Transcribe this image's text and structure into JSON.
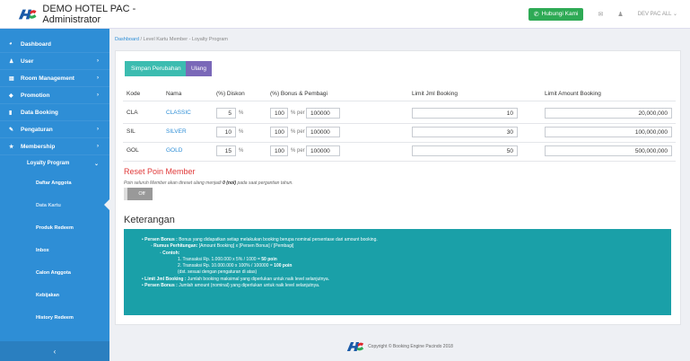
{
  "header": {
    "title": "DEMO HOTEL PAC - Administrator",
    "hubungi_label": "Hubungi Kami",
    "user_label": "DEV PAC ALL"
  },
  "sidebar": {
    "items": [
      {
        "label": "Dashboard",
        "icon": "dashboard-icon",
        "chevron": false
      },
      {
        "label": "User",
        "icon": "user-icon",
        "chevron": true
      },
      {
        "label": "Room Management",
        "icon": "room-icon",
        "chevron": true
      },
      {
        "label": "Promotion",
        "icon": "tag-icon",
        "chevron": true
      },
      {
        "label": "Data Booking",
        "icon": "book-icon",
        "chevron": false
      },
      {
        "label": "Pengaturan",
        "icon": "wrench-icon",
        "chevron": true
      },
      {
        "label": "Membership",
        "icon": "star-icon",
        "chevron": true
      }
    ],
    "submenu": "Loyalty Program",
    "subitems": [
      "Daftar Anggota",
      "Data Kartu",
      "Produk Redeem",
      "Inbox",
      "Calon Anggota",
      "Kebijakan",
      "History Redeem"
    ],
    "bottom_chevron": "‹"
  },
  "breadcrumb": {
    "home": "Dashboard",
    "separator": "/",
    "path": "Level Kartu Member - Loyalty Program"
  },
  "toolbar": {
    "save_label": "Simpan Perubahan",
    "reset_label": "Ulang"
  },
  "table": {
    "headers": [
      "Kode",
      "Nama",
      "(%) Diskon",
      "(%) Bonus & Pembagi",
      "Limit Jml Booking",
      "Limit Amount Booking"
    ],
    "unit_percent": "%",
    "unit_per": "% per",
    "rows": [
      {
        "kode": "CLA",
        "nama": "CLASSIC",
        "diskon": "5",
        "bonus": "100",
        "pembagi": "100000",
        "limit_booking": "10",
        "limit_amount": "20,000,000"
      },
      {
        "kode": "SIL",
        "nama": "SILVER",
        "diskon": "10",
        "bonus": "100",
        "pembagi": "100000",
        "limit_booking": "30",
        "limit_amount": "100,000,000"
      },
      {
        "kode": "GOL",
        "nama": "GOLD",
        "diskon": "15",
        "bonus": "100",
        "pembagi": "100000",
        "limit_booking": "50",
        "limit_amount": "500,000,000"
      }
    ]
  },
  "reset_poin": {
    "title": "Reset Poin Member",
    "desc_pre": "Poin seluruh Member akan direset ulang menjadi",
    "desc_bold": "0 (nol)",
    "desc_post": "pada saat pergantian tahun.",
    "toggle_label": "Off"
  },
  "keterangan": {
    "title": "Keterangan",
    "bonus_term": "Persen Bonus :",
    "bonus_text": "Bonus yang didapatkan setiap melakukan booking berupa nominal persentase dari amount booking.",
    "rumus_term": "Rumus Perhitungan:",
    "rumus_text": "[Amount Booking] x [Persen Bonus] / [Pembagi]",
    "contoh_term": "Contoh:",
    "contoh_1_pre": "1. Transaksi Rp. 1.000.000 x 5% / 1000 =",
    "contoh_1_bold": "50 poin",
    "contoh_2_pre": "2. Transaksi Rp. 10.000.000 x 100% / 100000 =",
    "contoh_2_bold": "100 poin",
    "contoh_note": "(dst. sesuai dengan pengaturan di atas)",
    "limit_jml_term": "Limit Jml Booking :",
    "limit_jml_text": "Jumlah booking maksimal yang diperlukan untuk naik level selanjutnya.",
    "limit_amt_term": "Persen Bonus :",
    "limit_amt_text": "Jumlah amount (nominal) yang diperlukan untuk naik level selanjutnya."
  },
  "footer": {
    "text": "Copyright © Booking Engine Pacindo 2018"
  },
  "colors": {
    "sidebar": "#2e8ed6",
    "save_button": "#3cbcb0",
    "reset_button": "#7a68b8",
    "info_box": "#1aa0a8",
    "reset_title": "#e03a3a",
    "hubungi_button": "#2eaa55"
  }
}
